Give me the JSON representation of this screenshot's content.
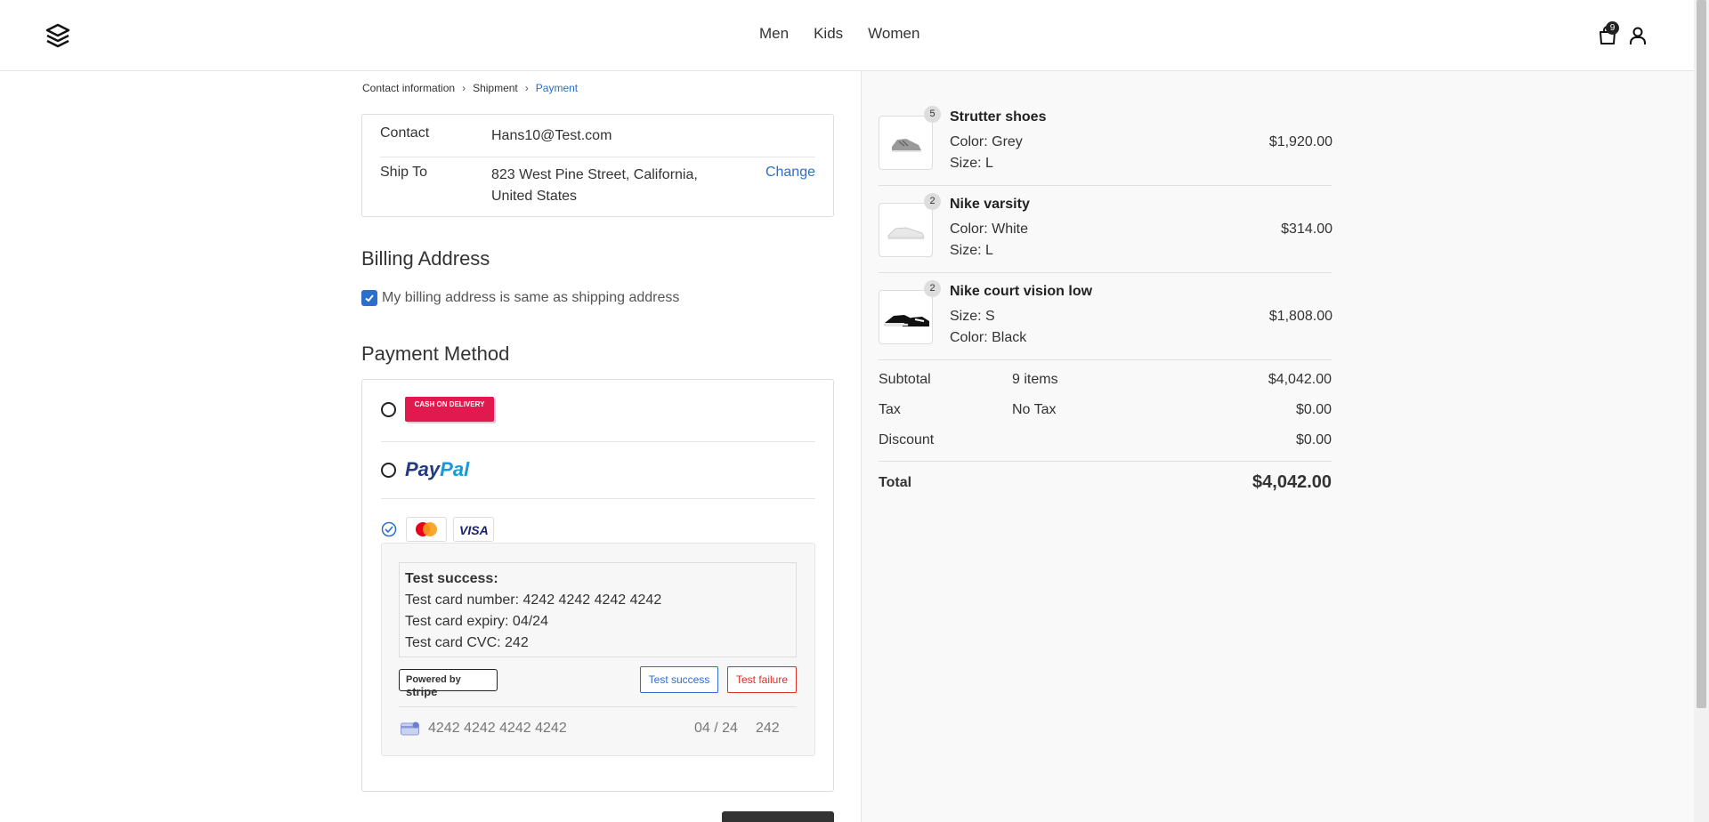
{
  "header": {
    "nav": [
      "Men",
      "Kids",
      "Women"
    ],
    "cart_count": "9"
  },
  "breadcrumb": {
    "step1": "Contact information",
    "step2": "Shipment",
    "step3": "Payment"
  },
  "contact": {
    "contact_label": "Contact",
    "contact_value": "Hans10@Test.com",
    "ship_label": "Ship To",
    "ship_value": "823 West Pine Street, California, United States",
    "change_label": "Change"
  },
  "billing": {
    "title": "Billing Address",
    "same_as_shipping": "My billing address is same as shipping address",
    "checked": true
  },
  "payment": {
    "title": "Payment Method",
    "cod_label": "CASH ON DELIVERY",
    "paypal_part1": "Pay",
    "paypal_part2": "Pal",
    "visa_label": "VISA",
    "test_title": "Test success:",
    "test_number": "Test card number: 4242 4242 4242 4242",
    "test_expiry": "Test card expiry: 04/24",
    "test_cvc": "Test card CVC: 242",
    "powered_by": "Powered by",
    "stripe": "stripe",
    "btn_success": "Test success",
    "btn_failure": "Test failure",
    "card_number": "4242 4242 4242 4242",
    "card_expiry": "04 / 24",
    "card_cvc": "242"
  },
  "order": {
    "items": [
      {
        "qty": "5",
        "name": "Strutter shoes",
        "attr1": "Color: Grey",
        "attr2": "Size: L",
        "price": "$1,920.00"
      },
      {
        "qty": "2",
        "name": "Nike varsity",
        "attr1": "Color: White",
        "attr2": "Size: L",
        "price": "$314.00"
      },
      {
        "qty": "2",
        "name": "Nike court vision low",
        "attr1": "Size: S",
        "attr2": "Color: Black",
        "price": "$1,808.00"
      }
    ],
    "subtotal_label": "Subtotal",
    "subtotal_items": "9 items",
    "subtotal_value": "$4,042.00",
    "tax_label": "Tax",
    "tax_desc": "No Tax",
    "tax_value": "$0.00",
    "discount_label": "Discount",
    "discount_value": "$0.00",
    "total_label": "Total",
    "total_value": "$4,042.00"
  },
  "colors": {
    "accent": "#2c6ecb",
    "cod": "#e01a4f",
    "failure": "#d93025"
  }
}
